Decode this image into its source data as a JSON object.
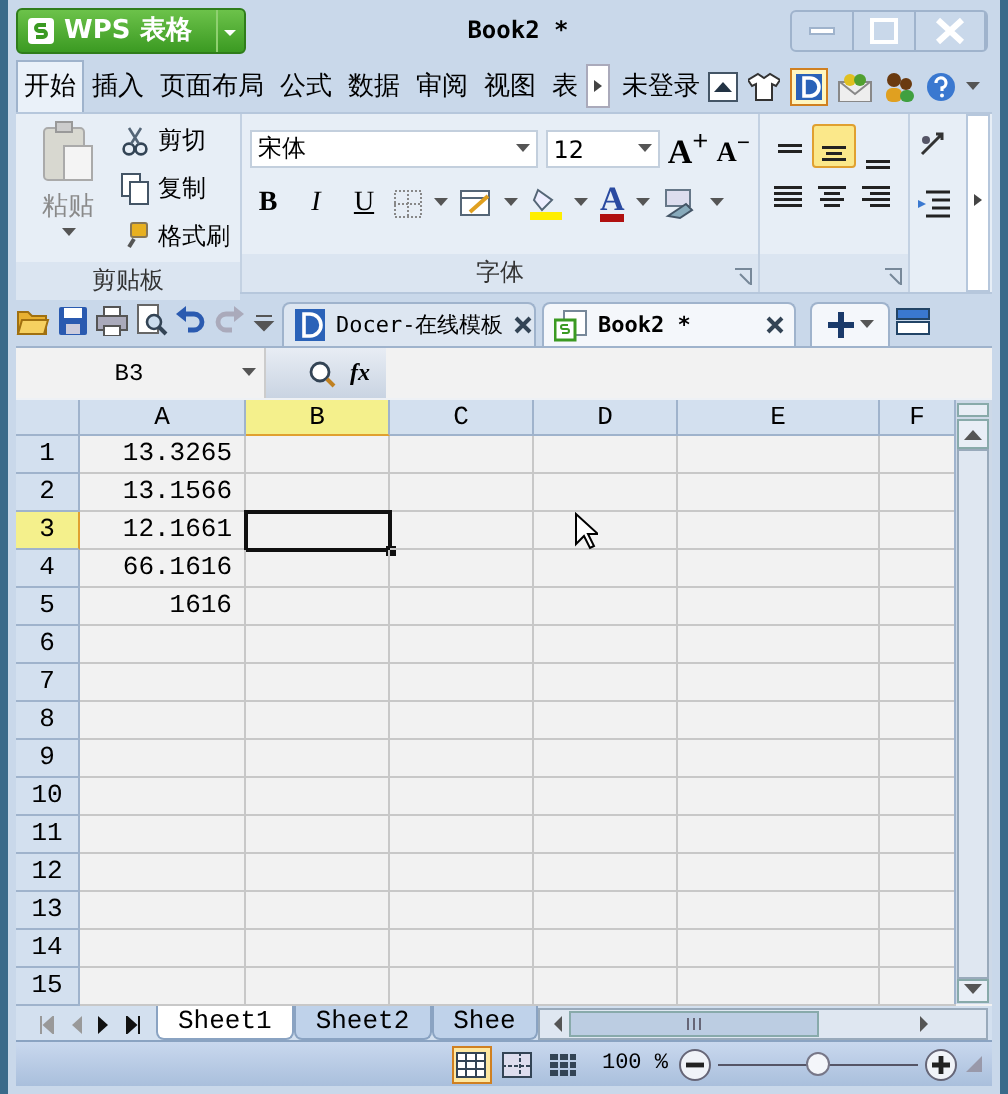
{
  "window": {
    "app_button": "WPS 表格",
    "title": "Book2 *"
  },
  "menu_tabs": [
    {
      "label": "开始",
      "selected": true
    },
    {
      "label": "插入",
      "selected": false
    },
    {
      "label": "页面布局",
      "selected": false
    },
    {
      "label": "公式",
      "selected": false
    },
    {
      "label": "数据",
      "selected": false
    },
    {
      "label": "审阅",
      "selected": false
    },
    {
      "label": "视图",
      "selected": false
    },
    {
      "label": "表",
      "selected": false
    }
  ],
  "account": "未登录",
  "ribbon": {
    "clipboard": {
      "paste": "粘贴",
      "cut": "剪切",
      "copy": "复制",
      "format_painter": "格式刷",
      "group_label": "剪贴板"
    },
    "font": {
      "name": "宋体",
      "size": "12",
      "grow": "A$^{+}$",
      "shrink": "A$^{−}$",
      "bold": "B",
      "italic": "I",
      "underline": "U",
      "font_color": "A",
      "group_label": "字体"
    },
    "vertical_align": [
      {
        "kind": "top",
        "selected": false
      },
      {
        "kind": "middle",
        "selected": true
      },
      {
        "kind": "bottom",
        "selected": false
      }
    ]
  },
  "doc_tabs": [
    {
      "kind": "docer",
      "label": "Docer-在线模板",
      "selected": false
    },
    {
      "kind": "sheet",
      "label": "Book2 *",
      "selected": true
    }
  ],
  "formula_bar": {
    "name_box": "B3",
    "fx": "fx"
  },
  "columns": [
    {
      "label": "A",
      "selected": false
    },
    {
      "label": "B",
      "selected": true
    },
    {
      "label": "C",
      "selected": false
    },
    {
      "label": "D",
      "selected": false
    },
    {
      "label": "E",
      "selected": false
    },
    {
      "label": "F",
      "selected": false
    }
  ],
  "rows": [
    {
      "header": "1",
      "selected": false,
      "cells": [
        "13.3265"
      ]
    },
    {
      "header": "2",
      "selected": false,
      "cells": [
        "13.1566"
      ]
    },
    {
      "header": "3",
      "selected": true,
      "cells": [
        "12.1661"
      ]
    },
    {
      "header": "4",
      "selected": false,
      "cells": [
        "66.1616"
      ]
    },
    {
      "header": "5",
      "selected": false,
      "cells": [
        "1616"
      ]
    },
    {
      "header": "6",
      "selected": false
    },
    {
      "header": "7",
      "selected": false
    },
    {
      "header": "8",
      "selected": false
    },
    {
      "header": "9",
      "selected": false
    },
    {
      "header": "10",
      "selected": false
    },
    {
      "header": "11",
      "selected": false
    },
    {
      "header": "12",
      "selected": false
    },
    {
      "header": "13",
      "selected": false
    },
    {
      "header": "14",
      "selected": false
    },
    {
      "header": "15",
      "selected": false
    }
  ],
  "sheet_tabs": [
    {
      "label": "Sheet1",
      "selected": true
    },
    {
      "label": "Sheet2",
      "selected": false
    },
    {
      "label": "Shee",
      "selected": false
    }
  ],
  "status_bar": {
    "views": [
      {
        "kind": "normal",
        "selected": true
      },
      {
        "kind": "page_break",
        "selected": false
      },
      {
        "kind": "layout",
        "selected": false
      }
    ],
    "zoom_label": "100 %",
    "zoom": {
      "level": 0.5
    }
  }
}
